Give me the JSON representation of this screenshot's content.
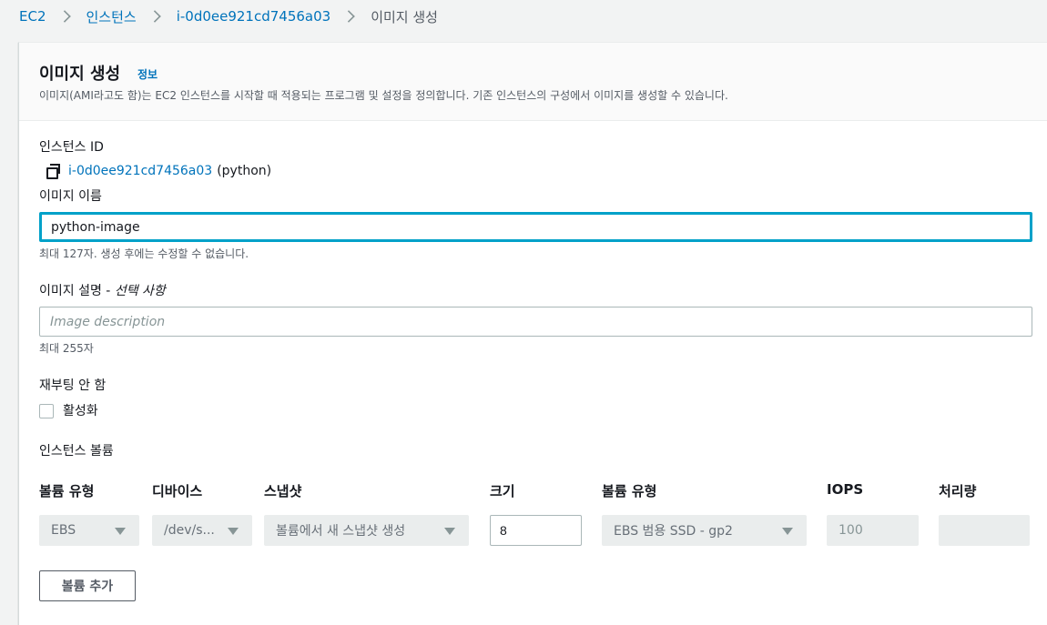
{
  "breadcrumb": {
    "items": [
      "EC2",
      "인스턴스",
      "i-0d0ee921cd7456a03"
    ],
    "current": "이미지 생성"
  },
  "header": {
    "title": "이미지 생성",
    "info_link": "정보",
    "description": "이미지(AMI라고도 함)는 EC2 인스턴스를 시작할 때 적용되는 프로그램 및 설정을 정의합니다. 기존 인스턴스의 구성에서 이미지를 생성할 수 있습니다."
  },
  "instance": {
    "label": "인스턴스 ID",
    "id": "i-0d0ee921cd7456a03",
    "name_suffix": "(python)",
    "icon": "copy-icon"
  },
  "image_name": {
    "label": "이미지 이름",
    "value": "python-image",
    "hint": "최대 127자. 생성 후에는 수정할 수 없습니다."
  },
  "image_description": {
    "label": "이미지 설명 - ",
    "optional": "선택 사항",
    "placeholder": "Image description",
    "hint": "최대 255자"
  },
  "no_reboot": {
    "label": "재부팅 안 함",
    "checkbox_label": "활성화",
    "checked": false
  },
  "volumes": {
    "section_label": "인스턴스 볼륨",
    "headers": {
      "volume_type": "볼륨 유형",
      "device": "디바이스",
      "snapshot": "스냅샷",
      "size": "크기",
      "ebs_type": "볼륨 유형",
      "iops": "IOPS",
      "throughput": "처리량"
    },
    "row": {
      "volume_type": "EBS",
      "device": "/dev/s...",
      "snapshot": "볼륨에서 새 스냅샷 생성",
      "size": "8",
      "ebs_type": "EBS 범용 SSD - gp2",
      "iops": "100",
      "throughput": ""
    },
    "add_button": "볼륨 추가"
  },
  "colors": {
    "link": "#0073bb",
    "focus": "#00a1c9",
    "background": "#f2f3f3"
  }
}
